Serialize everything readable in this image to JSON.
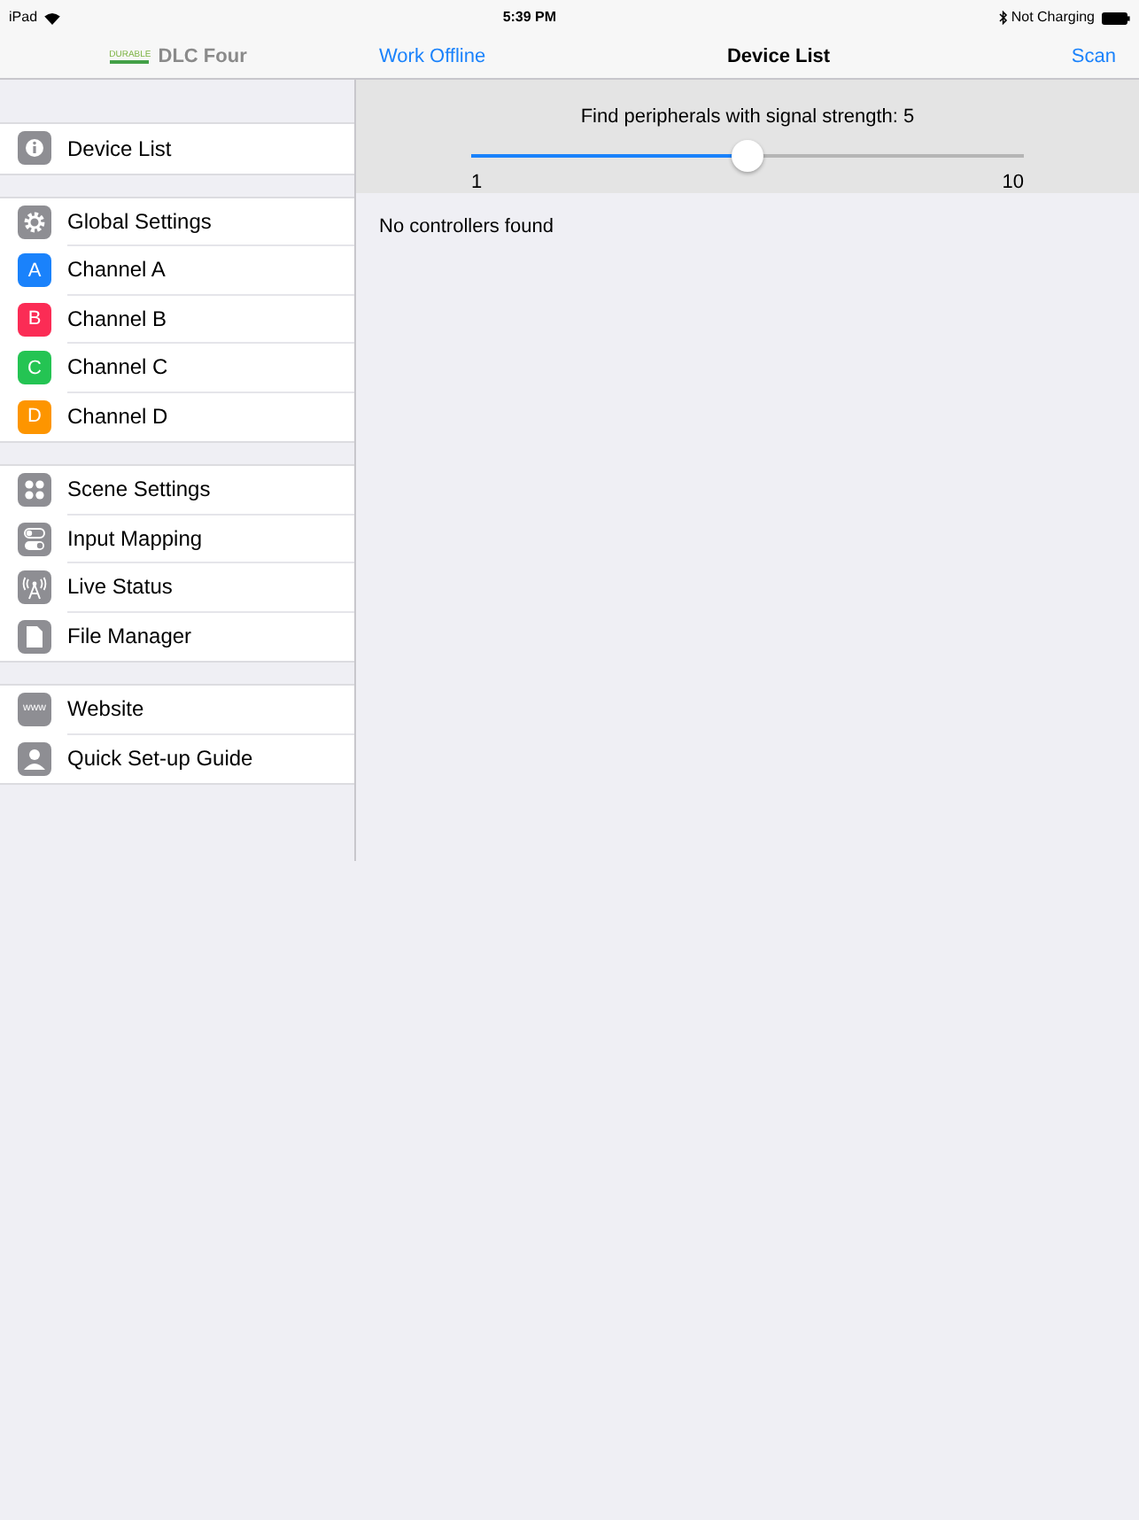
{
  "status_bar": {
    "device": "iPad",
    "time": "5:39 PM",
    "battery_text": "Not Charging"
  },
  "sidebar": {
    "logo_text": "DURABLE",
    "title": "DLC Four",
    "sections": [
      {
        "items": [
          {
            "kind": "info",
            "label": "Device List"
          }
        ]
      },
      {
        "items": [
          {
            "kind": "gear",
            "label": "Global Settings"
          },
          {
            "kind": "letter",
            "icon_text": "A",
            "color": "#1a82fb",
            "label": "Channel A"
          },
          {
            "kind": "letter",
            "icon_text": "B",
            "color": "#fb2c55",
            "label": "Channel B"
          },
          {
            "kind": "letter",
            "icon_text": "C",
            "color": "#24c453",
            "label": "Channel C"
          },
          {
            "kind": "letter",
            "icon_text": "D",
            "color": "#fd9500",
            "label": "Channel D"
          }
        ]
      },
      {
        "items": [
          {
            "kind": "scene",
            "label": "Scene Settings"
          },
          {
            "kind": "toggle",
            "label": "Input Mapping"
          },
          {
            "kind": "antenna",
            "label": "Live Status"
          },
          {
            "kind": "file",
            "label": "File Manager"
          }
        ]
      },
      {
        "items": [
          {
            "kind": "www",
            "icon_text": "www",
            "label": "Website"
          },
          {
            "kind": "person",
            "label": "Quick Set-up Guide"
          }
        ]
      }
    ]
  },
  "nav": {
    "left_button": "Work Offline",
    "title": "Device List",
    "right_button": "Scan"
  },
  "filter": {
    "label": "Find peripherals with signal strength: 5",
    "level": 0.5,
    "min_label": "1",
    "max_label": "10"
  },
  "message": "No controllers found"
}
